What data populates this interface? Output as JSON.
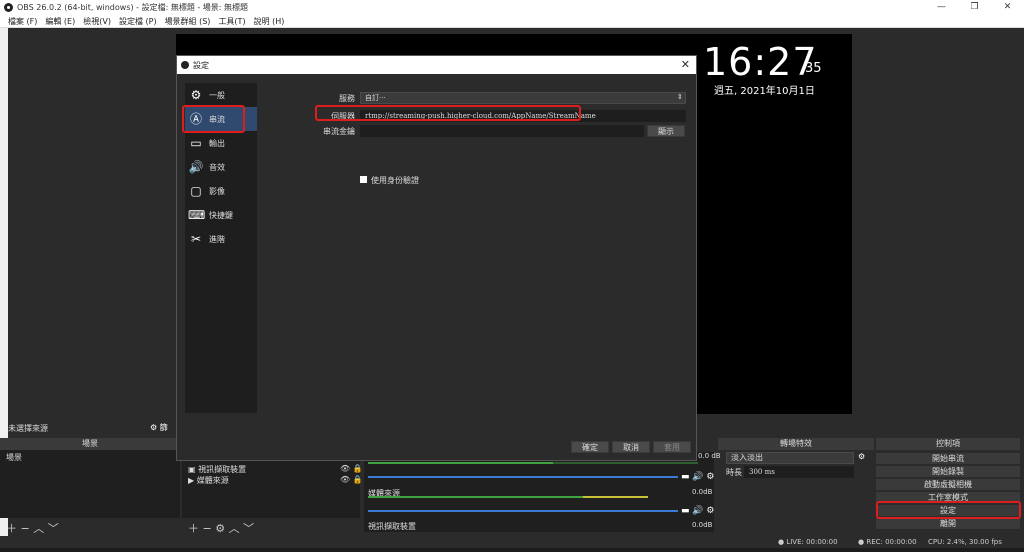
{
  "window": {
    "title": "OBS 26.0.2 (64-bit, windows) - 設定檔: 無標題 - 場景: 無標題",
    "buttons": [
      "—",
      "❐",
      "✕"
    ]
  },
  "menu": [
    "檔案 (F)",
    "編輯 (E)",
    "檢視(V)",
    "設定檔 (P)",
    "場景群組 (S)",
    "工具(T)",
    "說明 (H)"
  ],
  "preview": {
    "time": "16:27",
    "seconds": "35",
    "date": "週五, 2021年10月1日"
  },
  "settings_dialog": {
    "title": "設定",
    "sidebar": [
      {
        "label": "一般",
        "icon": "gear-icon",
        "glyph": "⚙"
      },
      {
        "label": "串流",
        "icon": "antenna-icon",
        "glyph": "📡",
        "active": true
      },
      {
        "label": "輸出",
        "icon": "output-icon",
        "glyph": "▭"
      },
      {
        "label": "音效",
        "icon": "speaker-icon",
        "glyph": "🔊"
      },
      {
        "label": "影像",
        "icon": "monitor-icon",
        "glyph": "🖥"
      },
      {
        "label": "快捷鍵",
        "icon": "keyboard-icon",
        "glyph": "⌨"
      },
      {
        "label": "進階",
        "icon": "tools-icon",
        "glyph": "✂"
      }
    ],
    "service_label": "服務",
    "service_value": "自訂···",
    "server_label": "伺服器",
    "server_value": "rtmp://streaming-push.higher-cloud.com/AppName/StreamName",
    "key_label": "串流金鑰",
    "key_value": "",
    "show_button": "顯示",
    "auth_label": "使用身份驗證",
    "ok": "確定",
    "cancel": "取消",
    "apply": "套用"
  },
  "docks": {
    "no_source": "未選擇來源",
    "filters_btn": "篩",
    "scenes_title": "場景",
    "scene_item": "場景",
    "sources": [
      "視訊擷取裝置",
      "媒體來源"
    ],
    "mixer": {
      "tracks": [
        {
          "name": "",
          "level": "0.0 dB"
        },
        {
          "name": "媒體來源",
          "level": "0.0dB"
        },
        {
          "name": "視訊擷取裝置",
          "level": "0.0dB"
        }
      ]
    },
    "transitions_title": "轉場特效",
    "transition_value": "淡入淡出",
    "duration_label": "時長",
    "duration_value": "300 ms",
    "controls_title": "控制項",
    "controls": [
      "開始串流",
      "開始錄製",
      "啟動虛擬相機",
      "工作室模式",
      "設定",
      "離開"
    ]
  },
  "status": {
    "live": "LIVE: 00:00:00",
    "rec": "REC: 00:00:00",
    "cpu": "CPU: 2.4%, 30.00 fps"
  },
  "colors": {
    "highlight": "#e01d1d",
    "active_side": "#2f4a6e",
    "meter_green": "#3fa33f",
    "meter_yellow": "#c7c235",
    "slider": "#3a7bd5"
  }
}
